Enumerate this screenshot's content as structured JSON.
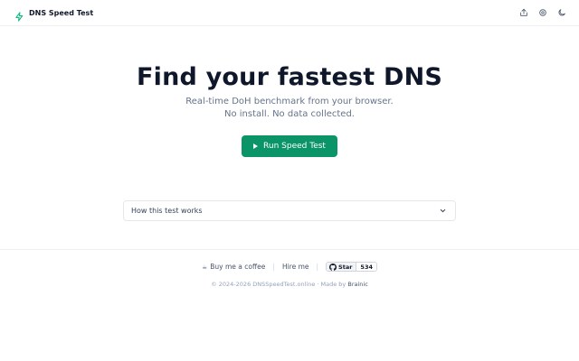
{
  "header": {
    "title": "DNS Speed Test",
    "brand_color": "#10b981",
    "actions": [
      {
        "name": "share-icon"
      },
      {
        "name": "settings-icon"
      },
      {
        "name": "moon-icon"
      }
    ]
  },
  "hero": {
    "title": "Find your fastest DNS",
    "subtitle_line1": "Real-time DoH benchmark from your browser.",
    "subtitle_line2": "No install. No data collected."
  },
  "run_button": {
    "label": "Run Speed Test",
    "color": "#0a9467"
  },
  "accordion": {
    "label": "How this test works"
  },
  "footer": {
    "coffee_label": "Buy me a coffee",
    "hire_label": "Hire me",
    "github_star_label": "Star",
    "github_star_count": "534",
    "copyright_prefix": "© 2024-2026 DNSSpeedTest.online · Made by",
    "maker": "Brainic"
  }
}
